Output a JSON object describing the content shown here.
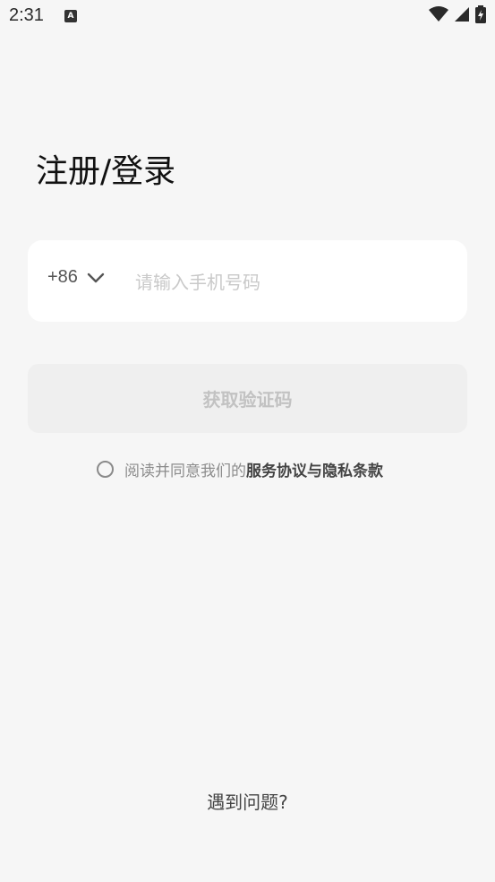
{
  "status_bar": {
    "time": "2:31",
    "notification_icon": "A",
    "icons": [
      "wifi-icon",
      "signal-icon",
      "battery-charging-icon"
    ]
  },
  "page": {
    "title": "注册/登录"
  },
  "phone_form": {
    "country_code": "+86",
    "placeholder": "请输入手机号码",
    "value": ""
  },
  "code_button": {
    "label": "获取验证码",
    "enabled": false
  },
  "agreement": {
    "checked": false,
    "prefix": "阅读并同意我们的",
    "service_link": "服务协议",
    "conjunction": "与",
    "privacy_link": "隐私条款"
  },
  "help": {
    "label": "遇到问题?"
  },
  "colors": {
    "background": "#f6f6f6",
    "card": "#ffffff",
    "disabled_button_bg": "#efefef",
    "disabled_button_text": "#c2c2c2"
  }
}
